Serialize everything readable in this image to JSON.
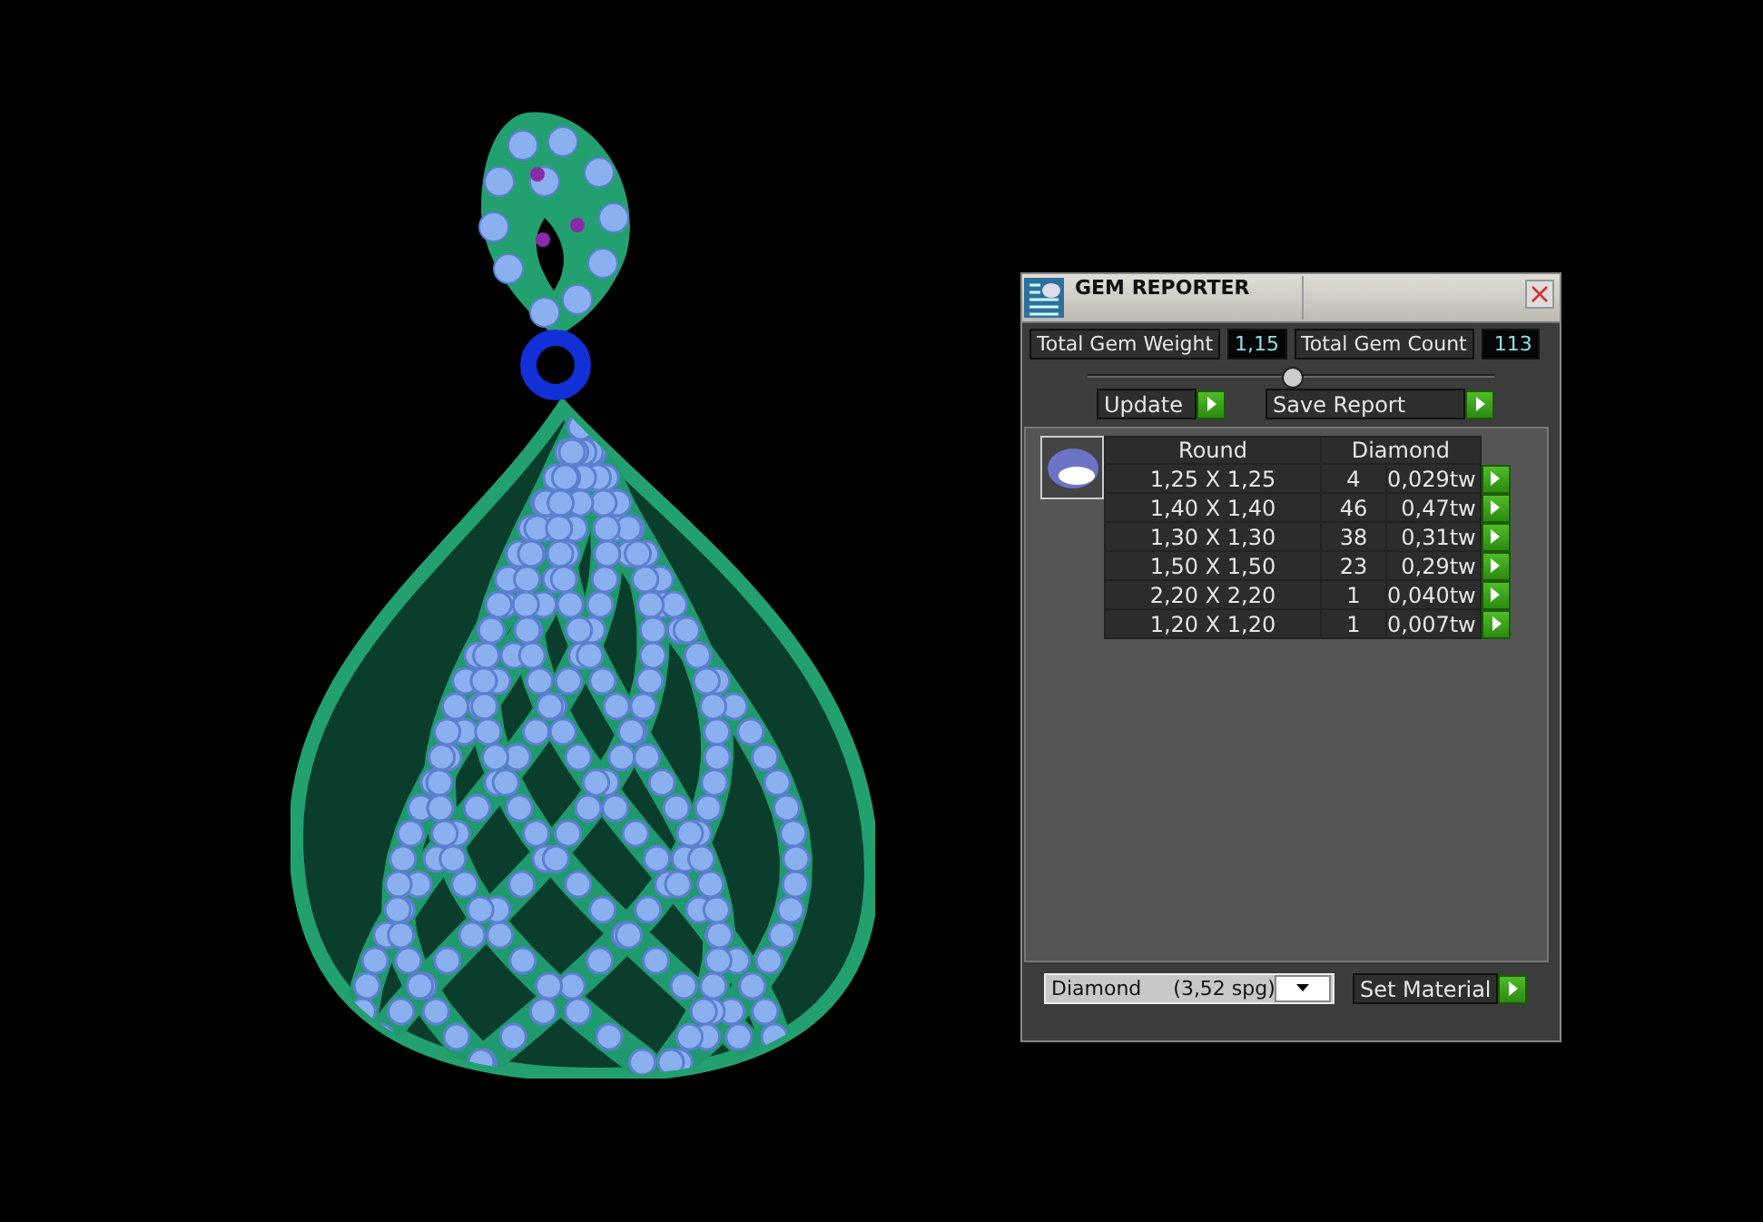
{
  "window": {
    "title": "GEM REPORTER"
  },
  "totals": [
    {
      "label": "Total Gem Weight",
      "value": "1,15"
    },
    {
      "label": "Total Gem Count",
      "value": "113"
    }
  ],
  "buttons": [
    {
      "label": "Update"
    },
    {
      "label": "Save Report"
    }
  ],
  "table": {
    "columns": [
      "Round",
      "Diamond"
    ],
    "rows": [
      {
        "size": "1,25 X 1,25",
        "count": "4",
        "weight": "0,029tw"
      },
      {
        "size": "1,40 X 1,40",
        "count": "46",
        "weight": "0,47tw"
      },
      {
        "size": "1,30 X 1,30",
        "count": "38",
        "weight": "0,31tw"
      },
      {
        "size": "1,50 X 1,50",
        "count": "23",
        "weight": "0,29tw"
      },
      {
        "size": "2,20 X 2,20",
        "count": "1",
        "weight": "0,040tw"
      },
      {
        "size": "1,20 X 1,20",
        "count": "1",
        "weight": "0,007tw"
      }
    ]
  },
  "material": {
    "value": "Diamond     (3,52 spg)",
    "button": "Set Material"
  }
}
